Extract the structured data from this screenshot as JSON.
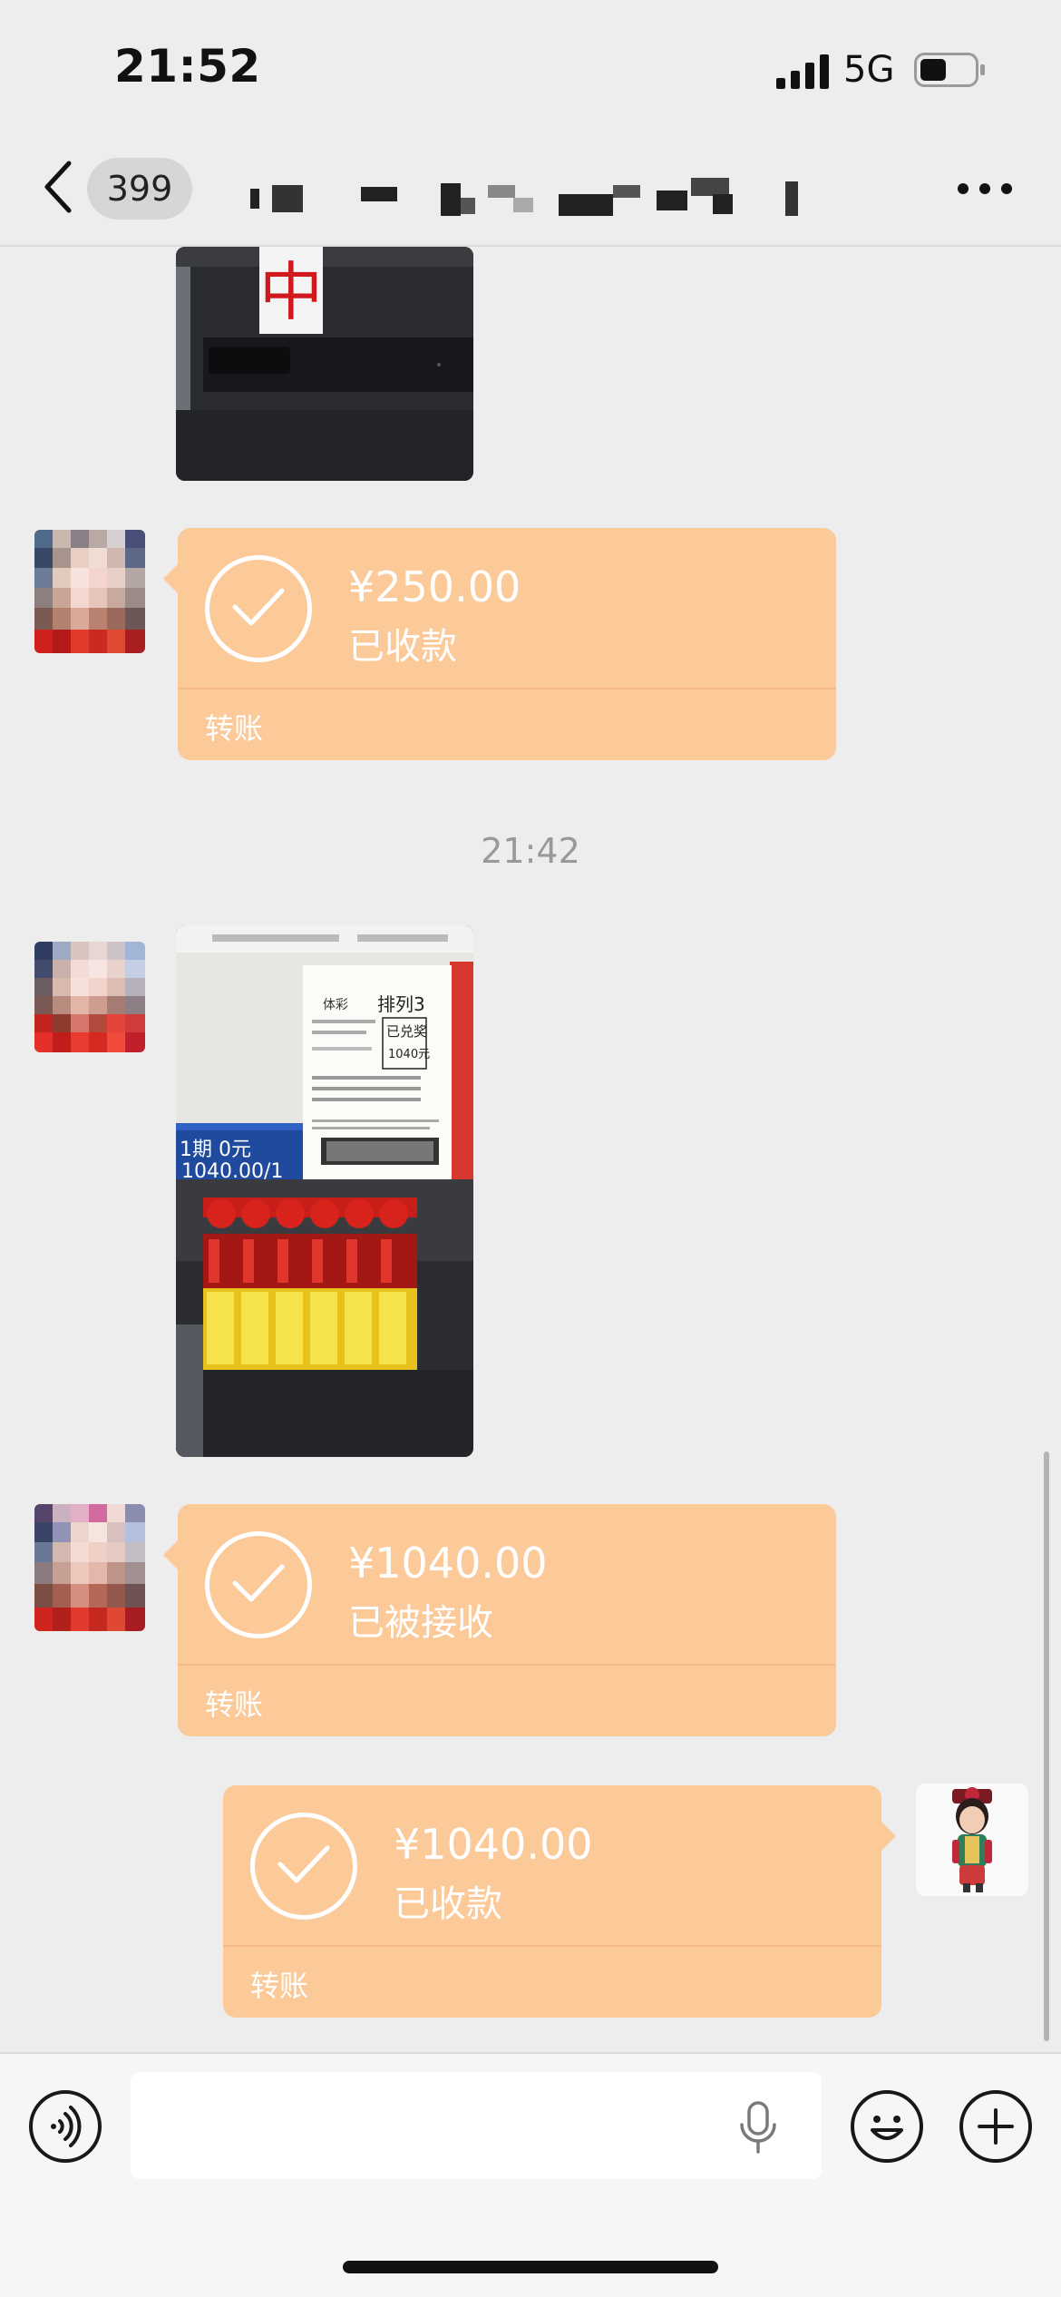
{
  "status_bar": {
    "time": "21:52",
    "network": "5G"
  },
  "header": {
    "back_badge": "399"
  },
  "messages": [
    {
      "type": "transfer",
      "side": "left",
      "amount": "¥250.00",
      "status": "已收款",
      "kind": "转账"
    },
    {
      "type": "timestamp",
      "text": "21:42"
    },
    {
      "type": "transfer",
      "side": "left",
      "amount": "¥1040.00",
      "status": "已被接收",
      "kind": "转账"
    },
    {
      "type": "transfer",
      "side": "right",
      "amount": "¥1040.00",
      "status": "已收款",
      "kind": "转账"
    }
  ],
  "ticket": {
    "game": "体彩",
    "name": "排列3",
    "stamp": "已兑奖",
    "prize": "1040元",
    "screen_line1": "1期 0元",
    "screen_line2": "1040.00/1"
  },
  "colors": {
    "transfer_bubble": "#fcc998",
    "background": "#ededed"
  },
  "icons": [
    "back-icon",
    "more-icon",
    "voice-toggle-icon",
    "microphone-icon",
    "emoji-icon",
    "plus-icon",
    "check-icon"
  ]
}
